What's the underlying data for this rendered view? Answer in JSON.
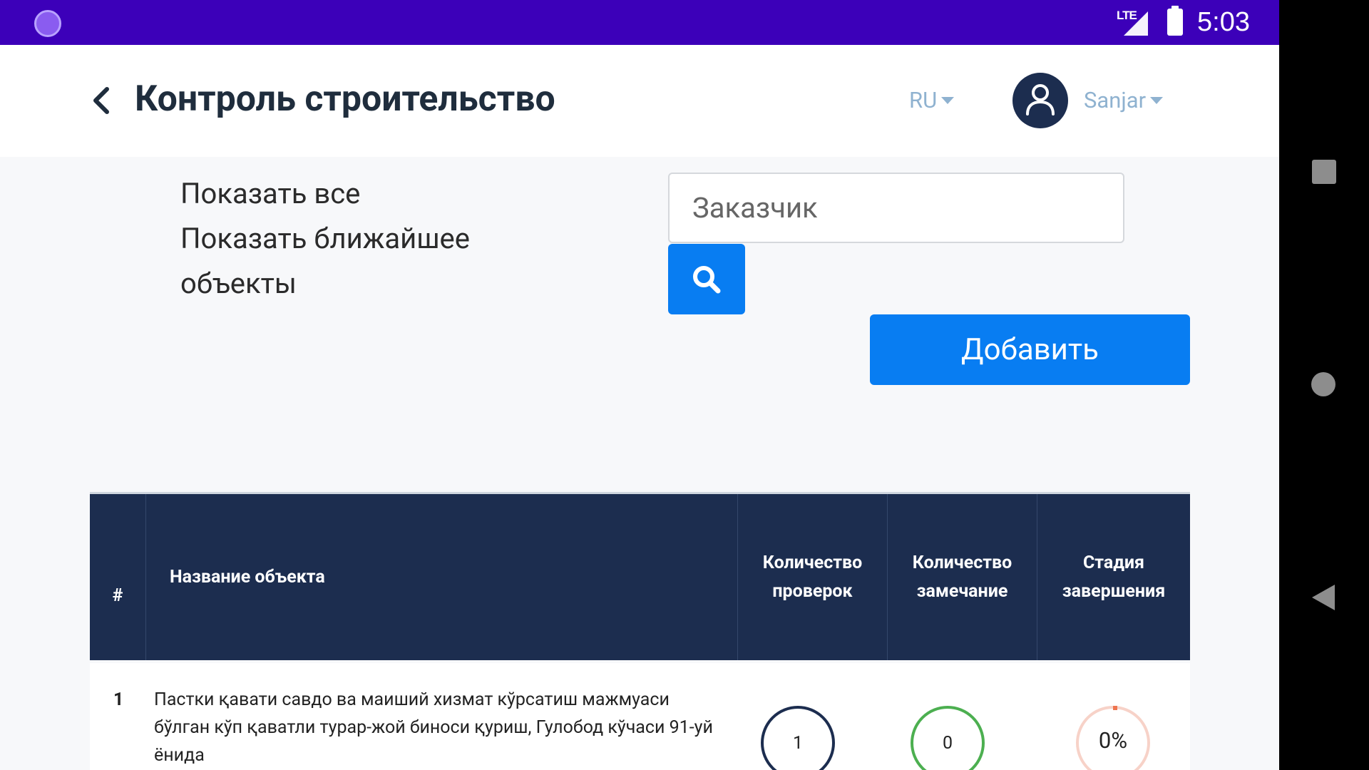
{
  "status_bar": {
    "network": "LTE",
    "time": "5:03"
  },
  "header": {
    "title": "Контроль строительство",
    "language": "RU",
    "user": "Sanjar"
  },
  "filters": {
    "show_all": "Показать все",
    "show_nearest_line1": "Показать ближайшее",
    "show_nearest_line2": "объекты"
  },
  "search": {
    "placeholder": "Заказчик"
  },
  "actions": {
    "add_label": "Добавить"
  },
  "table": {
    "columns": {
      "num": "#",
      "name": "Название объекта",
      "checks_line1": "Количество",
      "checks_line2": "проверок",
      "remarks_line1": "Количество",
      "remarks_line2": "замечание",
      "stage_line1": "Стадия",
      "stage_line2": "завершения"
    },
    "rows": [
      {
        "num": "1",
        "name": "Пастки қавати савдо ва маиший хизмат кўрсатиш мажмуаси бўлган кўп қаватли турар-жой биноси қуриш, Гулобод кўчаси 91-уй ёнида",
        "checks": "1",
        "remarks": "0",
        "stage": "0%"
      }
    ]
  }
}
